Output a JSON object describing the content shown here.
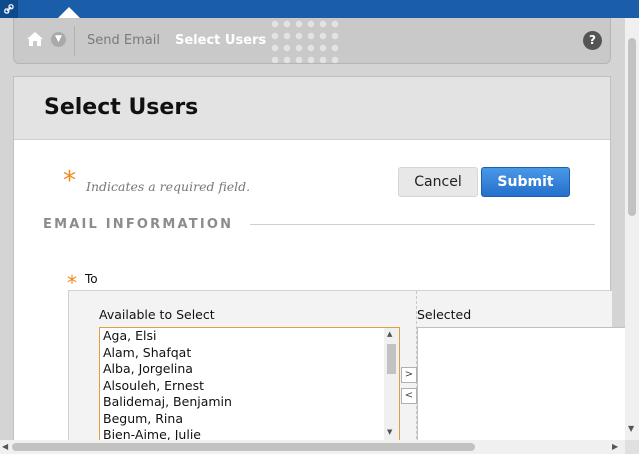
{
  "topbar": {
    "link_icon": "link-icon"
  },
  "breadcrumb": {
    "home_icon": "home-icon",
    "menu_icon": "chevron-down-icon",
    "items": [
      {
        "label": "Send Email"
      },
      {
        "label": "Select Users"
      }
    ],
    "help_label": "?"
  },
  "page": {
    "title": "Select Users",
    "required_star": "*",
    "required_note": "Indicates a required field.",
    "cancel_label": "Cancel",
    "submit_label": "Submit"
  },
  "section": {
    "heading": "EMAIL INFORMATION",
    "to_star": "*",
    "to_label": "To"
  },
  "picker": {
    "available_label": "Available to Select",
    "selected_label": "Selected",
    "available_items": [
      "Aga, Elsi",
      "Alam, Shafqat",
      "Alba, Jorgelina",
      "Alsouleh, Ernest",
      "Balidemaj, Benjamin",
      "Begum, Rina",
      "Bien-Aime, Julie"
    ],
    "selected_items": [],
    "move_right_label": ">",
    "move_left_label": "<"
  },
  "colors": {
    "topbar": "#1a5da8",
    "accent_orange": "#f08a1c",
    "submit_blue": "#2470cc"
  }
}
